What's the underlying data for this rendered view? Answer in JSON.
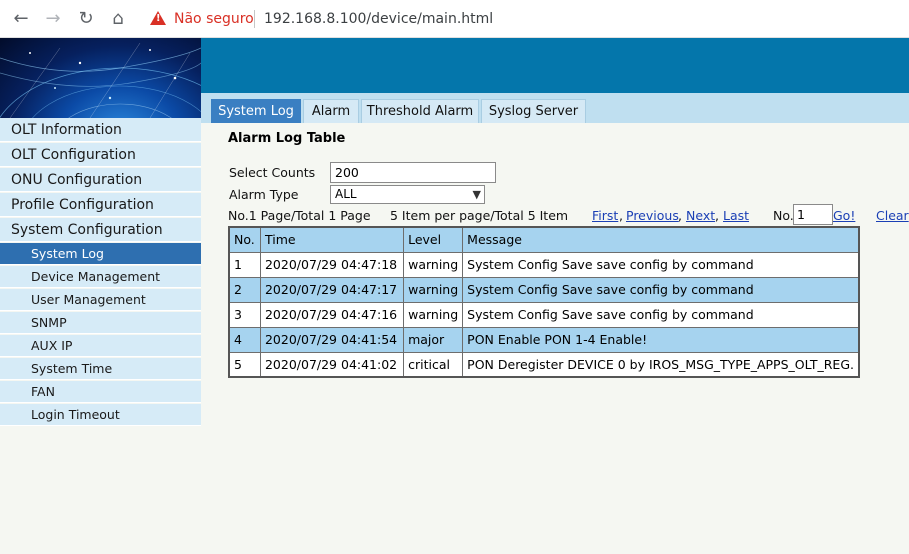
{
  "browser": {
    "security_label": "Não seguro",
    "url": "192.168.8.100/device/main.html"
  },
  "tabs": [
    {
      "label": "System Log",
      "active": true
    },
    {
      "label": "Alarm",
      "active": false
    },
    {
      "label": "Threshold Alarm",
      "active": false
    },
    {
      "label": "Syslog Server",
      "active": false
    }
  ],
  "sidebar": {
    "main_items": [
      {
        "label": "OLT Information"
      },
      {
        "label": "OLT Configuration"
      },
      {
        "label": "ONU Configuration"
      },
      {
        "label": "Profile Configuration"
      },
      {
        "label": "System Configuration"
      }
    ],
    "sub_items": [
      {
        "label": "System Log",
        "active": true
      },
      {
        "label": "Device Management",
        "active": false
      },
      {
        "label": "User Management",
        "active": false
      },
      {
        "label": "SNMP",
        "active": false
      },
      {
        "label": "AUX IP",
        "active": false
      },
      {
        "label": "System Time",
        "active": false
      },
      {
        "label": "FAN",
        "active": false
      },
      {
        "label": "Login Timeout",
        "active": false
      }
    ]
  },
  "main": {
    "title": "Alarm Log Table",
    "select_counts_label": "Select Counts",
    "select_counts_value": "200",
    "alarm_type_label": "Alarm Type",
    "alarm_type_value": "ALL",
    "page_info": "No.1 Page/Total 1 Page",
    "item_info": "5 Item per page/Total 5 Item",
    "nav": {
      "first": "First",
      "previous": "Previous",
      "next": "Next",
      "last": "Last",
      "sep": ",",
      "no_label": "No.",
      "page_value": "1",
      "go": "Go!",
      "clear": "Clear"
    },
    "table": {
      "headers": [
        "No.",
        "Time",
        "Level",
        "Message"
      ],
      "rows": [
        [
          "1",
          "2020/07/29 04:47:18",
          "warning",
          "System Config Save save config by command"
        ],
        [
          "2",
          "2020/07/29 04:47:17",
          "warning",
          "System Config Save save config by command"
        ],
        [
          "3",
          "2020/07/29 04:47:16",
          "warning",
          "System Config Save save config by command"
        ],
        [
          "4",
          "2020/07/29 04:41:54",
          "major",
          "PON Enable PON 1-4 Enable!"
        ],
        [
          "5",
          "2020/07/29 04:41:02",
          "critical",
          "PON Deregister DEVICE 0 by IROS_MSG_TYPE_APPS_OLT_REG."
        ]
      ]
    }
  },
  "colors": {
    "banner": "#0476ab",
    "active_menu": "#2e6fb0",
    "menu_bg": "#d6ebf7",
    "table_stripe": "#a6d3ef",
    "link": "#1a3fb5",
    "warning_red": "#d93025"
  }
}
